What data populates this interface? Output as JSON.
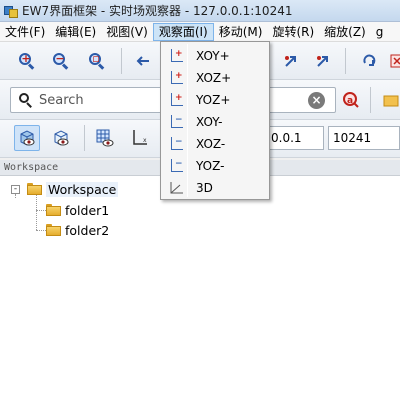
{
  "window": {
    "title": "EW7界面框架 - 实时场观察器 - 127.0.0.1:10241"
  },
  "menubar": {
    "items": [
      {
        "label": "文件(F)"
      },
      {
        "label": "编辑(E)"
      },
      {
        "label": "视图(V)"
      },
      {
        "label": "观察面(I)"
      },
      {
        "label": "移动(M)"
      },
      {
        "label": "旋转(R)"
      },
      {
        "label": "缩放(Z)"
      },
      {
        "label": "g"
      }
    ],
    "active_index": 3
  },
  "toolbar1": {
    "icons": [
      "zoom-in-icon",
      "zoom-out-icon",
      "zoom-fit-icon",
      "move-left-icon",
      "rotate-icon",
      "reset-icon"
    ]
  },
  "search": {
    "placeholder": "Search",
    "value": ""
  },
  "connection": {
    "ip": "0.0.1",
    "port": "10241"
  },
  "workspace": {
    "header": "Workspace",
    "root": {
      "label": "Workspace",
      "expander": "-"
    },
    "children": [
      {
        "label": "folder1"
      },
      {
        "label": "folder2"
      }
    ]
  },
  "view_menu": {
    "items": [
      {
        "label": "XOY+",
        "icon": "plane-xoy-plus-icon"
      },
      {
        "label": "XOZ+",
        "icon": "plane-xoz-plus-icon"
      },
      {
        "label": "YOZ+",
        "icon": "plane-yoz-plus-icon"
      },
      {
        "label": "XOY-",
        "icon": "plane-xoy-minus-icon"
      },
      {
        "label": "XOZ-",
        "icon": "plane-xoz-minus-icon"
      },
      {
        "label": "YOZ-",
        "icon": "plane-yoz-minus-icon"
      },
      {
        "label": "3D",
        "icon": "view-3d-icon"
      }
    ]
  },
  "colors": {
    "accent": "#7eb4ea",
    "menu_highlight": "#cde4f7",
    "icon_blue": "#2c5aa8",
    "icon_red": "#c0231b"
  }
}
